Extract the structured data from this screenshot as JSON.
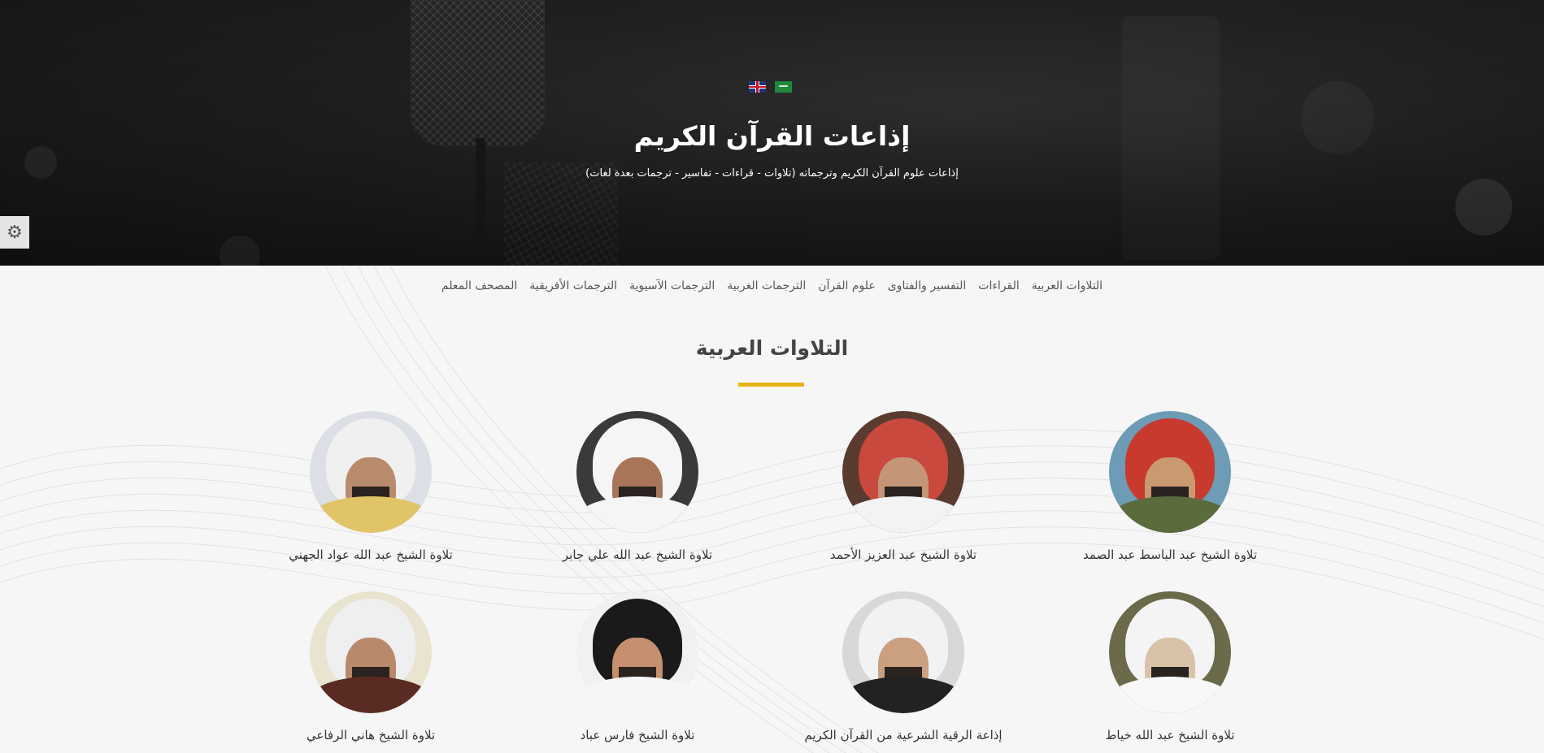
{
  "hero": {
    "title": "إذاعات القرآن الكريم",
    "subtitle": "إذاعات علوم القرآن الكريم وترجماته (تلاوات - قراءات - تفاسير - ترجمات بعدة لغات)",
    "languages": [
      "English",
      "العربية"
    ]
  },
  "settings": {
    "icon": "gear-icon"
  },
  "nav": {
    "items": [
      "التلاوات العربية",
      "القراءات",
      "التفسير والفتاوى",
      "علوم القرآن",
      "الترجمات الغربية",
      "الترجمات الآسيوية",
      "الترجمات الأفريقية",
      "المصحف المعلم"
    ]
  },
  "section": {
    "title": "التلاوات العربية"
  },
  "reciters": [
    {
      "label": "تلاوة الشيخ عبد الباسط عبد الصمد",
      "bg": "#6e9bb6",
      "skin": "#c99a72",
      "cover": "#c83a2e",
      "cloth": "#5a6b3c"
    },
    {
      "label": "تلاوة الشيخ عبد العزيز الأحمد",
      "bg": "#5a3b30",
      "skin": "#c49576",
      "cover": "#c9493f",
      "cloth": "#f3f3f3"
    },
    {
      "label": "تلاوة الشيخ عبد الله علي جابر",
      "bg": "#3a3a3a",
      "skin": "#a87558",
      "cover": "#f5f5f5",
      "cloth": "#f5f5f5"
    },
    {
      "label": "تلاوة الشيخ عبد الله عواد الجهني",
      "bg": "#dcdfe6",
      "skin": "#b98a6c",
      "cover": "#f0f0f0",
      "cloth": "#e0c467"
    },
    {
      "label": "تلاوة الشيخ عبد الله خياط",
      "bg": "#6b6a4a",
      "skin": "#d8c2a8",
      "cover": "#f4f4f4",
      "cloth": "#f8f8f8"
    },
    {
      "label": "إذاعة الرقية الشرعية من القرآن الكريم",
      "bg": "#d8d8d8",
      "skin": "#caa080",
      "cover": "#f2f2f2",
      "cloth": "#222222"
    },
    {
      "label": "تلاوة الشيخ فارس عباد",
      "bg": "#f1f1f1",
      "skin": "#c49070",
      "cover": "#1a1a1a",
      "cloth": "#f6f6f6"
    },
    {
      "label": "تلاوة الشيخ هاني الرفاعي",
      "bg": "#e9e4cf",
      "skin": "#b88a6b",
      "cover": "#efefef",
      "cloth": "#5a2b22"
    }
  ]
}
